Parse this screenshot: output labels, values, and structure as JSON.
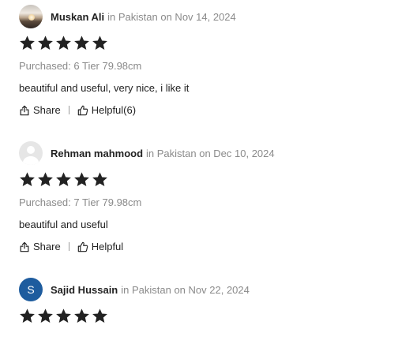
{
  "reviews": [
    {
      "name": "Muskan Ali",
      "meta": "in Pakistan on Nov 14, 2024",
      "rating": 5,
      "purchased": "Purchased: 6 Tier 79.98cm",
      "text": "beautiful and useful, very nice, i like it",
      "share_label": "Share",
      "helpful_label": "Helpful(6)"
    },
    {
      "name": "Rehman mahmood",
      "meta": "in Pakistan on Dec 10, 2024",
      "rating": 5,
      "purchased": "Purchased: 7 Tier 79.98cm",
      "text": "beautiful and useful",
      "share_label": "Share",
      "helpful_label": "Helpful"
    },
    {
      "name": "Sajid Hussain",
      "avatar_letter": "S",
      "meta": "in Pakistan on Nov 22, 2024",
      "rating": 5
    }
  ],
  "colors": {
    "star": "#222222",
    "meta_text": "#8a8a8a",
    "avatar_letter_bg": "#1e5c9e"
  },
  "icons": {
    "star": "star-icon",
    "share": "share-icon",
    "helpful": "thumbs-up-icon"
  }
}
